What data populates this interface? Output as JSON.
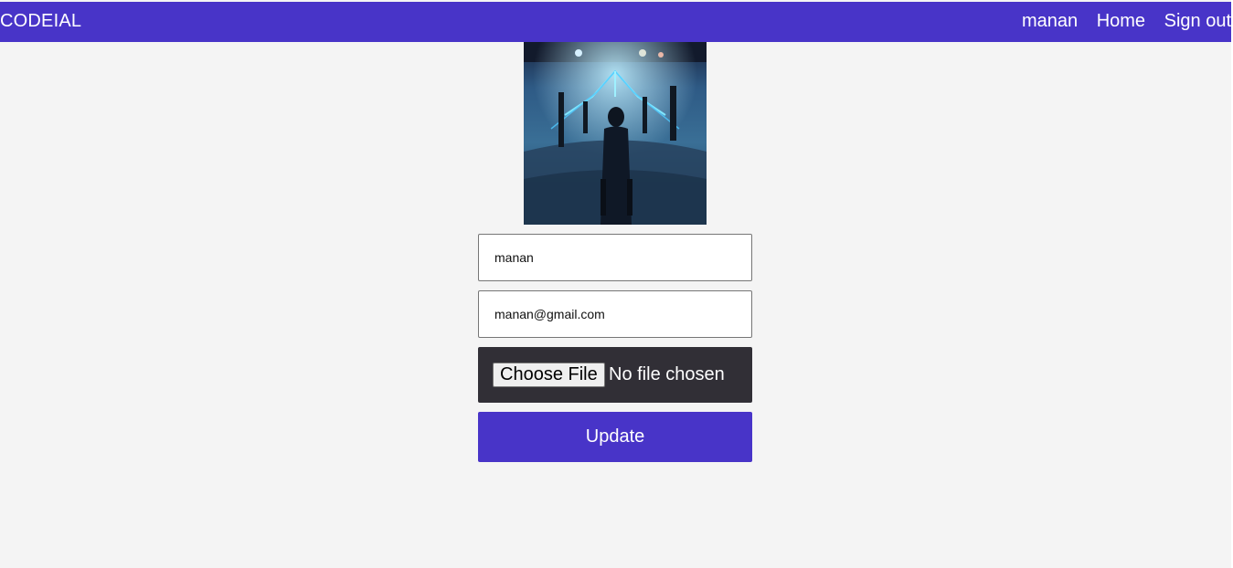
{
  "navbar": {
    "brand": "CODEIAL",
    "username": "manan",
    "home_label": "Home",
    "signout_label": "Sign out"
  },
  "profile_form": {
    "name_value": "manan",
    "email_value": "manan@gmail.com",
    "file_button_label": "Choose File",
    "file_status": "No file chosen",
    "submit_label": "Update"
  },
  "colors": {
    "accent": "#4834c8",
    "file_box_bg": "#312f36",
    "page_bg": "#f4f4f4"
  }
}
